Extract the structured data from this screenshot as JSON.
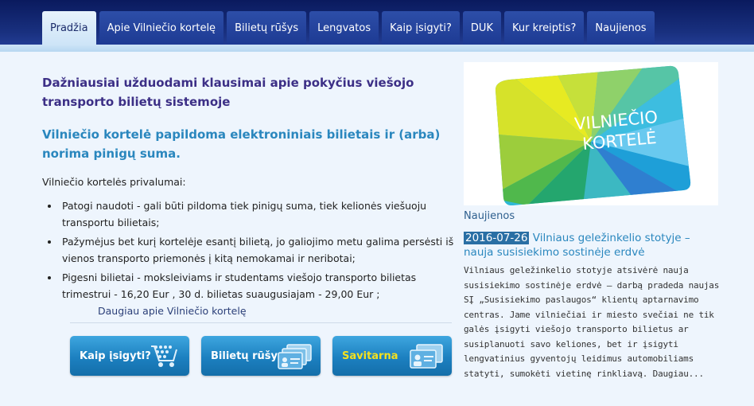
{
  "nav": {
    "tabs": [
      {
        "label": "Pradžia"
      },
      {
        "label": "Apie Vilniečio kortelę"
      },
      {
        "label": "Bilietų rūšys"
      },
      {
        "label": "Lengvatos"
      },
      {
        "label": "Kaip įsigyti?"
      },
      {
        "label": "DUK"
      },
      {
        "label": "Kur kreiptis?"
      },
      {
        "label": "Naujienos"
      }
    ]
  },
  "main": {
    "headline": "Dažniausiai užduodami klausimai apie pokyčius viešojo transporto bilietų sistemoje",
    "subheadline": "Vilniečio kortelė papildoma elektroniniais bilietais ir (arba) norima pinigų suma.",
    "intro": "Vilniečio kortelės privalumai:",
    "benefits": [
      "Patogi naudoti - gali būti pildoma tiek pinigų suma, tiek kelionės viešuoju transportu bilietais;",
      "Pažymėjus bet kurį kortelėje esantį bilietą, jo galiojimo metu galima persėsti iš vienos transporto priemonės į kitą nemokamai ir neribotai;",
      "Pigesni bilietai - moksleiviams ir studentams viešojo transporto bilietas trimestrui - 16,20 Eur , 30 d. bilietas suaugusiajam - 29,00 Eur ;"
    ],
    "more_link": "Daugiau apie Vilniečio kortelę"
  },
  "buttons": {
    "buy": "Kaip įsigyti?",
    "ticket_types": "Bilietų rūšys",
    "self_service": "Savitarna"
  },
  "card": {
    "line1": "VILNIEČIO",
    "line2": "KORTELĖ"
  },
  "news": {
    "section_title": "Naujienos",
    "date": "2016-07-26",
    "headline": "Vilniaus geležinkelio stotyje – nauja susisiekimo sostinėje erdvė",
    "body": "Vilniaus geležinkelio stotyje atsivėrė nauja susisiekimo sostinėje erdvė – darbą pradeda naujas SĮ „Susisiekimo paslaugos“ klientų aptarnavimo centras. Jame vilniečiai ir miesto svečiai ne tik galės įsigyti viešojo transporto bilietus ar susiplanuoti savo keliones, bet ir įsigyti lengvatinius gyventojų leidimus automobiliams statyti, sumokėti vietinę rinkliavą.",
    "more": "Daugiau..."
  },
  "colors": {
    "nav_dark": "#0a1a5e",
    "accent": "#2a87be",
    "headline": "#3c2f86",
    "button": "#1c80c0",
    "button_highlight_text": "#f5e11e"
  }
}
